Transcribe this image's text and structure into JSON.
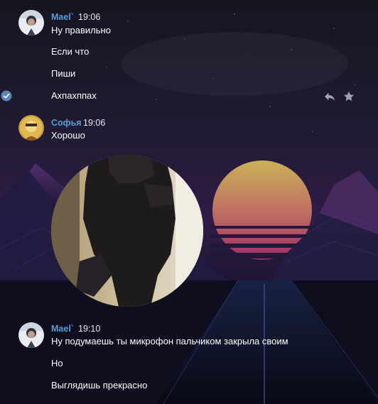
{
  "chat": {
    "groups": [
      {
        "author": "Mael`",
        "time": "19:06",
        "avatar_icon": "user-photo-avatar",
        "messages": [
          "Ну правильно",
          "Если что",
          "Пиши",
          "Ахпахппах"
        ]
      },
      {
        "author": "Софья",
        "time": "19:06",
        "avatar_icon": "user-photo-avatar",
        "messages": [
          "Хорошо"
        ],
        "attachment": "video-message"
      },
      {
        "author": "Mael`",
        "time": "19:10",
        "avatar_icon": "user-photo-avatar",
        "messages": [
          "Ну подумаешь ты микрофон пальчиком закрыла своим",
          "Но",
          "Выглядишь прекрасно"
        ]
      }
    ]
  },
  "icons": {
    "selected": "check-circle-icon",
    "reply": "reply-arrow-icon",
    "favorite": "star-icon"
  },
  "colors": {
    "author_name": "#5a9bd6",
    "message_text": "#ffffff",
    "sun_top": "#f5d86a",
    "sun_bottom": "#d2418e",
    "sky": "#2a2140",
    "mountains": "#6a3c8e"
  }
}
